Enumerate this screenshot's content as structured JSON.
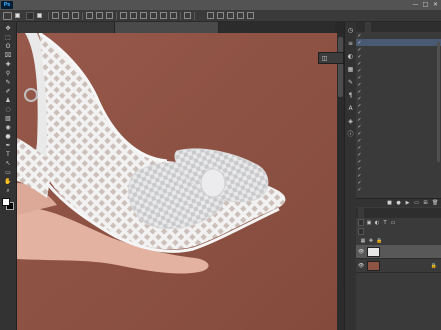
{
  "app": {
    "logo": "Ps"
  },
  "menu": {
    "items": [
      "",
      "",
      "",
      "",
      "",
      "",
      "",
      "",
      "",
      "",
      ""
    ]
  },
  "window_controls": {
    "minimize": "—",
    "maximize": "□",
    "close": "✕"
  },
  "options": {
    "auto_select_label": "",
    "target": "",
    "show_transform_label": ""
  },
  "tabs": [
    {
      "title": ""
    },
    {
      "title": "",
      "active": true
    }
  ],
  "toolbar": {
    "tools": [
      "✥",
      "⬚",
      "ʘ",
      "⌧",
      "✚",
      "⚲",
      "✎",
      "✐",
      "♟",
      "◌",
      "▧",
      "◉",
      "●",
      "✒",
      "T",
      "↖",
      "▭",
      "✋",
      "⌕"
    ],
    "foreground": "#ffffff",
    "background": "#000000"
  },
  "flyout": {
    "label": ""
  },
  "panels": {
    "history_tabs": [
      "",
      ""
    ],
    "history": [
      {
        "name": "",
        "key": "",
        "indent": 0
      },
      {
        "name": "",
        "key": "",
        "indent": 0
      },
      {
        "name": "",
        "key": "",
        "indent": 0
      },
      {
        "name": "",
        "key": "",
        "indent": 0
      },
      {
        "name": "",
        "key": "",
        "indent": 0
      },
      {
        "name": "",
        "key": "",
        "indent": 0
      },
      {
        "name": "",
        "key": "",
        "indent": 0
      },
      {
        "name": "",
        "key": "",
        "indent": 0
      },
      {
        "name": "",
        "key": "",
        "indent": 0
      },
      {
        "name": "",
        "key": "",
        "indent": 0
      },
      {
        "name": "",
        "key": "",
        "indent": 0
      },
      {
        "name": "",
        "key": "",
        "indent": 0
      },
      {
        "name": "",
        "key": "",
        "indent": 0
      },
      {
        "name": "",
        "key": "",
        "indent": 0
      },
      {
        "name": "",
        "key": "",
        "indent": 0
      },
      {
        "name": "",
        "key": "",
        "indent": 0
      },
      {
        "name": "",
        "key": "",
        "indent": 0
      },
      {
        "name": "",
        "key": "",
        "indent": 0
      },
      {
        "name": "",
        "key": "",
        "indent": 0
      },
      {
        "name": "",
        "key": "",
        "indent": 0
      },
      {
        "name": "",
        "key": "",
        "indent": 0
      },
      {
        "name": "",
        "key": "",
        "indent": 0
      },
      {
        "name": "",
        "key": "",
        "indent": 0
      }
    ],
    "layers_tabs": [
      "",
      "",
      ""
    ],
    "layers": {
      "filter": "",
      "blend_mode": "",
      "opacity": "",
      "lock_label": "",
      "fill": "",
      "items": [
        {
          "name": "",
          "active": true
        },
        {
          "name": "",
          "active": false
        }
      ]
    }
  }
}
